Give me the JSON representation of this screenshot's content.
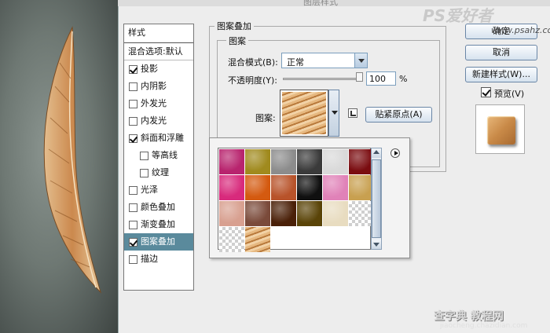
{
  "dialog": {
    "title": "图层样式"
  },
  "styles_panel": {
    "header": "样式",
    "blend_options": "混合选项:默认",
    "items": [
      {
        "label": "投影",
        "checked": true,
        "sub": false,
        "selected": false
      },
      {
        "label": "内阴影",
        "checked": false,
        "sub": false,
        "selected": false
      },
      {
        "label": "外发光",
        "checked": false,
        "sub": false,
        "selected": false
      },
      {
        "label": "内发光",
        "checked": false,
        "sub": false,
        "selected": false
      },
      {
        "label": "斜面和浮雕",
        "checked": true,
        "sub": false,
        "selected": false
      },
      {
        "label": "等高线",
        "checked": false,
        "sub": true,
        "selected": false
      },
      {
        "label": "纹理",
        "checked": false,
        "sub": true,
        "selected": false
      },
      {
        "label": "光泽",
        "checked": false,
        "sub": false,
        "selected": false
      },
      {
        "label": "颜色叠加",
        "checked": false,
        "sub": false,
        "selected": false
      },
      {
        "label": "渐变叠加",
        "checked": false,
        "sub": false,
        "selected": false
      },
      {
        "label": "图案叠加",
        "checked": true,
        "sub": false,
        "selected": true
      },
      {
        "label": "描边",
        "checked": false,
        "sub": false,
        "selected": false
      }
    ]
  },
  "pattern_overlay": {
    "section_title": "图案叠加",
    "group_title": "图案",
    "blend_mode_label": "混合模式(B):",
    "blend_mode_value": "正常",
    "opacity_label": "不透明度(Y):",
    "opacity_value": "100",
    "opacity_unit": "%",
    "pattern_label": "图案:",
    "snap_button": "贴紧原点(A)"
  },
  "buttons": {
    "ok": "确定",
    "cancel": "取消",
    "new_style": "新建样式(W)...",
    "preview_label": "预览(V)",
    "preview_checked": true
  },
  "pattern_swatches": [
    "#b8246e",
    "#a08a1e",
    "#8c8c8c",
    "#3a3a3a",
    "#d9d9d9",
    "#7a0c10",
    "#d82a7c",
    "#d45a10",
    "#b8532a",
    "#101010",
    "#e082b8",
    "#c8a050",
    "#d8a090",
    "#7a4a3a",
    "#4a2008",
    "#5a4408",
    "#e8dcc0",
    "checker",
    "checker",
    "fur"
  ],
  "watermarks": {
    "top": "PS爱好者",
    "url": "www.psahz.com",
    "bottom": "查字典 教程网",
    "bottom_url": "jiaocheng.chazidian.com"
  }
}
